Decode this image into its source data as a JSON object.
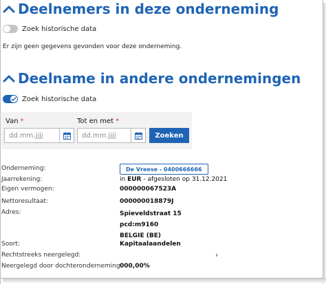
{
  "section1": {
    "title": "Deelnemers in deze onderneming",
    "toggle_label": "Zoek historische data",
    "empty_message": "Er zijn geen gegevens gevonden voor deze onderneming."
  },
  "section2": {
    "title": "Deelname in andere ondernemingen",
    "toggle_label": "Zoek historische data"
  },
  "filter": {
    "from_label": "Van",
    "to_label": "Tot en met",
    "required_mark": "*",
    "from_placeholder": "dd.mm.jjjj",
    "to_placeholder": "dd.mm.jjjj",
    "search_label": "Zoeken"
  },
  "details": {
    "onderneming_label": "Onderneming:",
    "onderneming_value": "De Vreese - 0400666666",
    "jaarrekening_label": "Jaarrekening:",
    "jaarrekening_prefix": "in",
    "jaarrekening_currency": "EUR",
    "jaarrekening_suffix": "- afgesloten op",
    "jaarrekening_date": "31.12.2021",
    "eigen_vermogen_label": "Eigen vermogen:",
    "eigen_vermogen_value": "000000067523A",
    "nettoresultaat_label": "Nettoresultaat:",
    "nettoresultaat_value": "000000018879J",
    "adres_label": "Adres:",
    "adres_line1": "Spieveldstraat 15",
    "adres_line2": "pcd:m9160",
    "adres_line3": "BELGIE (BE)",
    "soort_label": "Soort:",
    "soort_value": "Kapitaalaandelen",
    "rechtstreeks_label": "Rechtstreeks neergelegd:",
    "rechtstreeks_arrow": "›",
    "dochter_label": "Neergelegd door dochteronderneming:",
    "dochter_value": "000,00%"
  },
  "colors": {
    "accent": "#1f64b4",
    "required": "#d33333",
    "filter_bg": "#f2f2f2"
  },
  "icons": [
    "chevron-up-icon",
    "check-icon",
    "calendar-icon"
  ]
}
